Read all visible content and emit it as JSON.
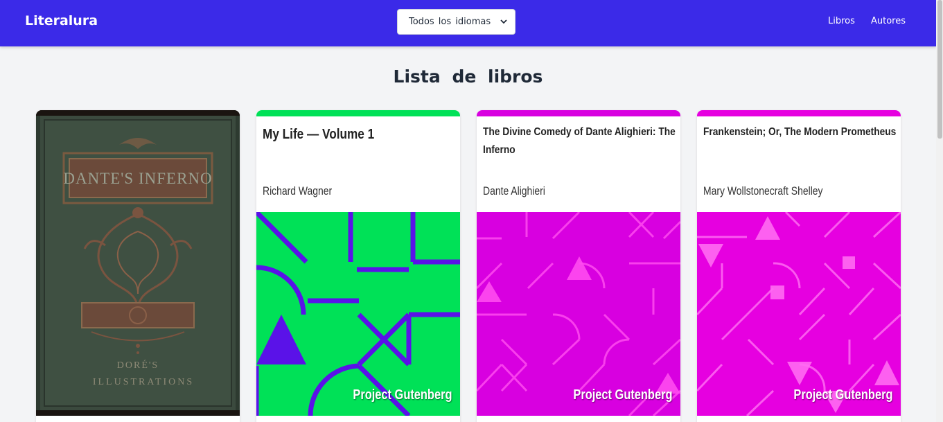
{
  "app": {
    "brand": "Literalura"
  },
  "language_filter": {
    "selected": "Todos los idiomas"
  },
  "nav": {
    "books": "Libros",
    "authors": "Autores"
  },
  "page": {
    "title": "Lista de libros"
  },
  "books": [
    {
      "title": "",
      "author": "",
      "cover": "illustrated-cover",
      "cover_text": [
        "DANTE'S INFERNO",
        "DORÉ'S",
        "ILLUSTRATIONS"
      ]
    },
    {
      "title": "My Life — Volume 1",
      "author": "Richard Wagner",
      "cover": "generated-cover",
      "cover_label": "Project Gutenberg",
      "color": "#00e157",
      "accent": "#5a12e8"
    },
    {
      "title": "The Divine Comedy of Dante Alighieri: The Inferno",
      "author": "Dante Alighieri",
      "cover": "generated-cover",
      "cover_label": "Project Gutenberg",
      "color": "#d800e0",
      "accent": "#ff4bf0"
    },
    {
      "title": "Frankenstein; Or, The Modern Prometheus",
      "author": "Mary Wollstonecraft Shelley",
      "cover": "generated-cover",
      "cover_label": "Project Gutenberg",
      "color": "#e600e0",
      "accent": "#ff6af2"
    }
  ]
}
